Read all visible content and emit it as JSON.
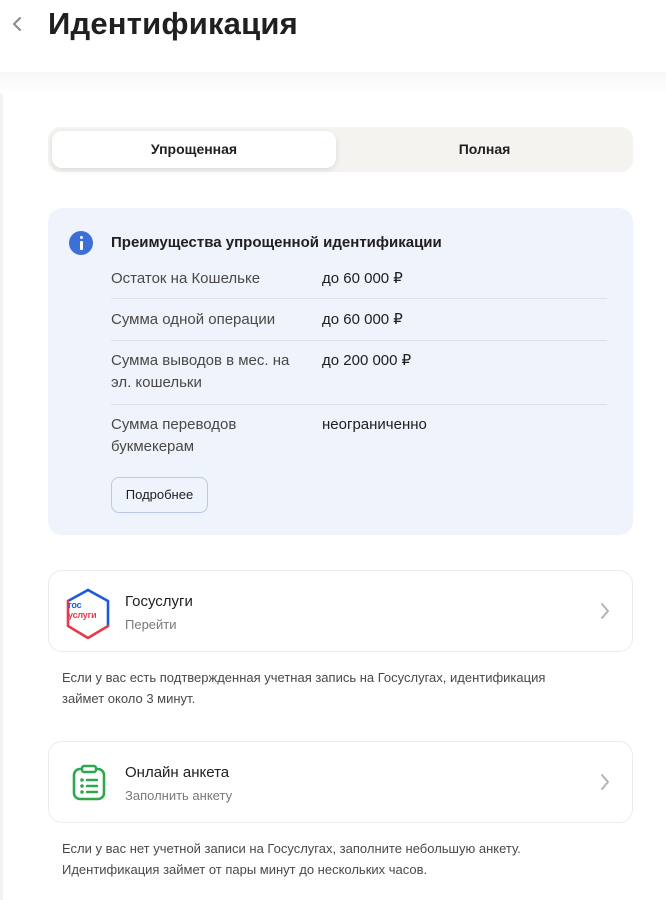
{
  "header": {
    "back_icon": "chevron-left-icon",
    "title": "Идентификация"
  },
  "tabs": [
    {
      "label": "Упрощенная",
      "active": true
    },
    {
      "label": "Полная",
      "active": false
    }
  ],
  "info": {
    "icon": "info-icon",
    "title": "Преимущества упрощенной идентификации",
    "rows": [
      {
        "label": "Остаток на Кошельке",
        "value": "до 60 000 ₽"
      },
      {
        "label": "Сумма одной операции",
        "value": "до 60 000 ₽"
      },
      {
        "label": "Сумма выводов в мес. на эл. кошельки",
        "value": "до 200 000 ₽"
      },
      {
        "label": "Сумма переводов букмекерам",
        "value": "неограниченно"
      }
    ],
    "more_label": "Подробнее"
  },
  "gosuslugi": {
    "logo_line1": "гос",
    "logo_line2": "услуги",
    "title": "Госуслуги",
    "subtitle": "Перейти",
    "note": "Если у вас есть подтвержденная учетная запись на Госуслугах, идентификация займет около 3 минут."
  },
  "anketa": {
    "icon": "clipboard-list-icon",
    "title": "Онлайн анкета",
    "subtitle": "Заполнить анкету",
    "note": "Если у вас нет учетной записи на Госуслугах, заполните небольшую анкету. Идентификация займет от пары минут до нескольких часов."
  },
  "colors": {
    "accent_blue": "#3d6fd9",
    "info_bg": "#eef3fc",
    "anketa_green": "#2ea84f",
    "gos_blue": "#1c5ad6",
    "gos_red": "#e63a4c"
  }
}
